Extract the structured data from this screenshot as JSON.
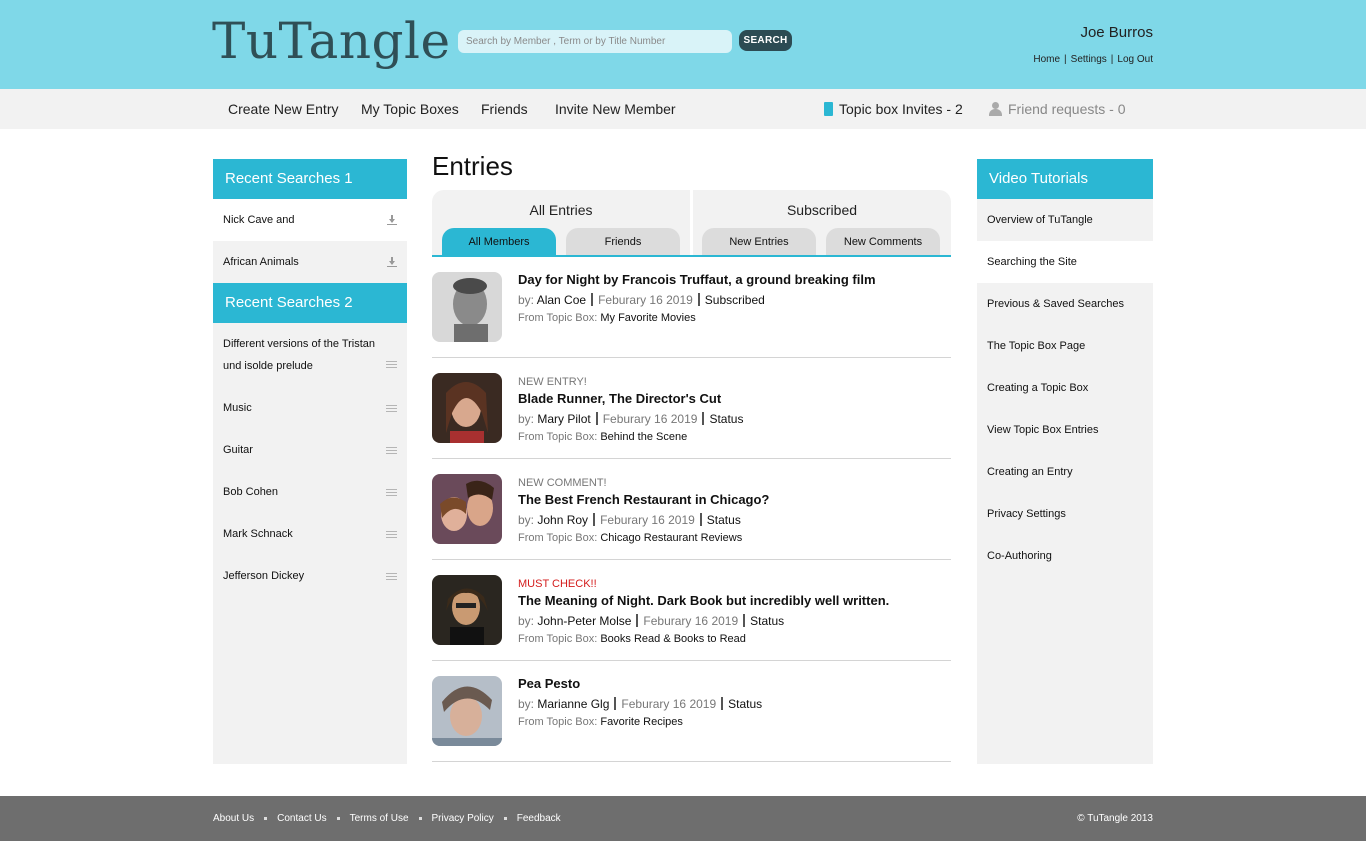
{
  "header": {
    "logo": "TuTangle",
    "search_placeholder": "Search by Member , Term or by Title Number",
    "search_button": "SEARCH",
    "user_name": "Joe Burros",
    "links": [
      "Home",
      "Settings",
      "Log Out"
    ]
  },
  "nav": {
    "items": [
      "Create New Entry",
      "My Topic Boxes",
      "Friends",
      "Invite New Member"
    ],
    "topic_box_invites": "Topic box Invites - 2",
    "friend_requests": "Friend requests - 0"
  },
  "recent_searches_1": {
    "title": "Recent Searches 1",
    "items": [
      "Nick Cave and",
      "African Animals"
    ]
  },
  "recent_searches_2": {
    "title": "Recent Searches 2",
    "items": [
      "Different versions of the Tristan und isolde prelude",
      "Music",
      "Guitar",
      "Bob Cohen",
      "Mark Schnack",
      "Jefferson Dickey"
    ]
  },
  "main": {
    "title": "Entries",
    "group1_label": "All Entries",
    "group2_label": "Subscribed",
    "tabs": [
      "All Members",
      "Friends",
      "New Entries",
      "New Comments"
    ],
    "active_tab": "All Members",
    "by_label": "by:",
    "from_label": "From Topic Box:",
    "entries": [
      {
        "tag": "",
        "title": "Day for Night by Francois Truffaut, a ground breaking film",
        "author": "Alan Coe",
        "date": "Feburary 16 2019",
        "status": "Subscribed",
        "topic_box": "My Favorite Movies"
      },
      {
        "tag": "NEW ENTRY!",
        "title": "Blade Runner, The Director's Cut",
        "author": "Mary Pilot",
        "date": "Feburary 16 2019",
        "status": "Status",
        "topic_box": "Behind the Scene"
      },
      {
        "tag": "NEW COMMENT!",
        "title": "The Best French Restaurant in Chicago?",
        "author": "John Roy",
        "date": "Feburary 16 2019",
        "status": "Status",
        "topic_box": "Chicago Restaurant Reviews"
      },
      {
        "tag": "MUST CHECK!!",
        "title": "The Meaning of Night. Dark Book but incredibly well written.",
        "author": "John-Peter Molse",
        "date": "Feburary 16 2019",
        "status": "Status",
        "topic_box": "Books Read & Books to Read"
      },
      {
        "tag": "",
        "title": "Pea Pesto",
        "author": "Marianne Glg",
        "date": "Feburary 16 2019",
        "status": "Status",
        "topic_box": "Favorite Recipes"
      }
    ]
  },
  "video_tutorials": {
    "title": "Video Tutorials",
    "items": [
      "Overview of TuTangle",
      "Searching the Site",
      "Previous & Saved Searches",
      "The Topic Box Page",
      "Creating a Topic Box",
      "View Topic Box Entries",
      "Creating an Entry",
      "Privacy Settings",
      "Co-Authoring"
    ]
  },
  "footer": {
    "links": [
      "About Us",
      "Contact Us",
      "Terms of Use",
      "Privacy Policy",
      "Feedback"
    ],
    "copyright": "© TuTangle 2013"
  },
  "colors": {
    "header_bg": "#7fd8e8",
    "accent": "#2bb7d3",
    "search_button_bg": "#2c4b53",
    "footer_bg": "#6e6e6e",
    "alert_red": "#d41c1c"
  }
}
